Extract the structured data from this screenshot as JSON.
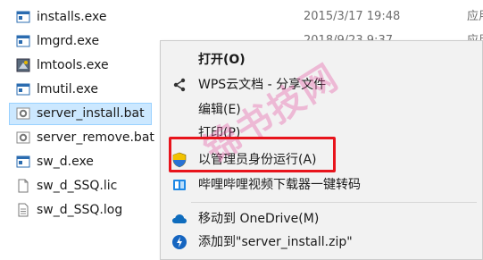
{
  "files": [
    {
      "name": "installs.exe",
      "date": "2015/3/17 19:48",
      "type": "应用",
      "icon": "exe-icon",
      "selected": false
    },
    {
      "name": "lmgrd.exe",
      "date": "2018/9/23 9:37",
      "type": "应用",
      "icon": "exe-icon",
      "selected": false
    },
    {
      "name": "lmtools.exe",
      "date": "",
      "type": "",
      "icon": "tools-icon",
      "selected": false
    },
    {
      "name": "lmutil.exe",
      "date": "",
      "type": "",
      "icon": "exe-icon",
      "selected": false
    },
    {
      "name": "server_install.bat",
      "date": "",
      "type": "",
      "icon": "bat-gear-icon",
      "selected": true
    },
    {
      "name": "server_remove.bat",
      "date": "",
      "type": "",
      "icon": "bat-gear-icon",
      "selected": false
    },
    {
      "name": "sw_d.exe",
      "date": "",
      "type": "",
      "icon": "exe-icon",
      "selected": false
    },
    {
      "name": "sw_d_SSQ.lic",
      "date": "",
      "type": "",
      "icon": "document-icon",
      "selected": false
    },
    {
      "name": "sw_d_SSQ.log",
      "date": "",
      "type": "",
      "icon": "text-document-icon",
      "selected": false
    }
  ],
  "watermark": "锦书技网",
  "menu": {
    "open": "打开(O)",
    "wps_share": "WPS云文档 - 分享文件",
    "edit": "编辑(E)",
    "print": "打印(P)",
    "run_as_admin": "以管理员身份运行(A)",
    "bilibili_download": "哔哩哔哩视频下载器一键转码",
    "move_onedrive": "移动到 OneDrive(M)",
    "add_to_zip": "添加到\"server_install.zip\""
  },
  "colors": {
    "highlight_border": "#e8141c",
    "selection_bg": "#cce8ff",
    "menu_bg": "#f2f2f2"
  }
}
